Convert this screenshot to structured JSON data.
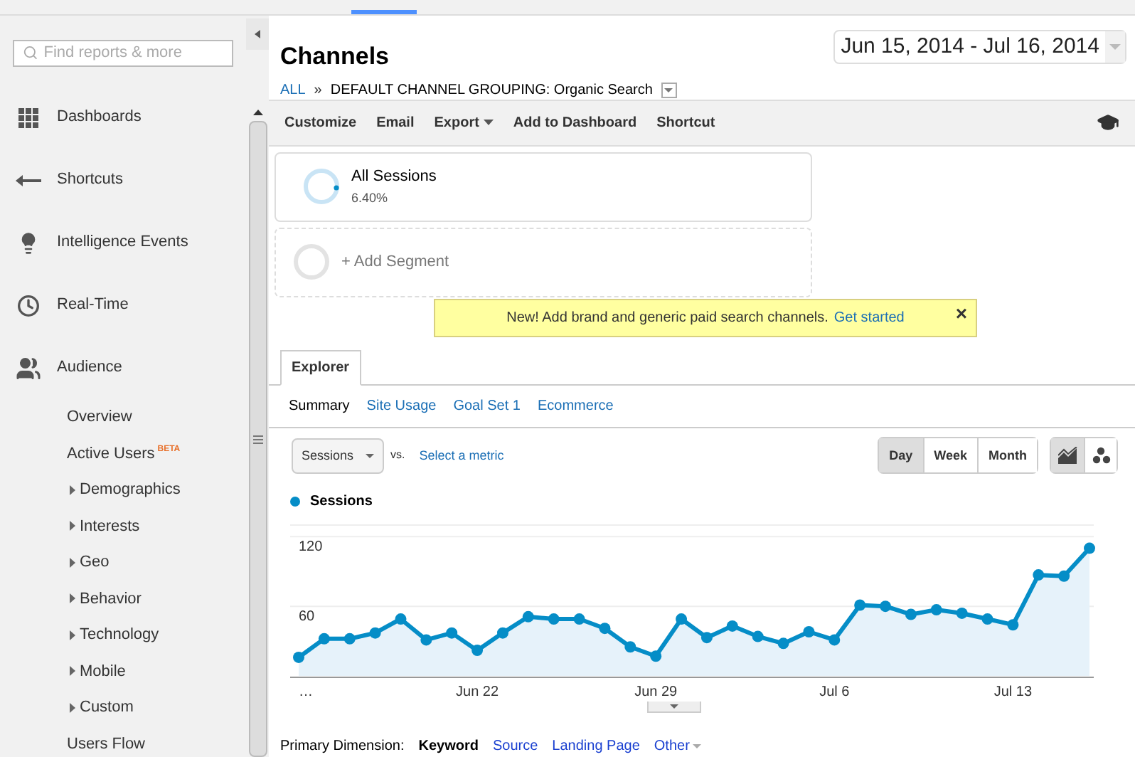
{
  "sidebar": {
    "search": {
      "placeholder": "Find reports & more"
    },
    "nav": [
      {
        "label": "Dashboards"
      },
      {
        "label": "Shortcuts"
      },
      {
        "label": "Intelligence Events"
      },
      {
        "label": "Real-Time"
      },
      {
        "label": "Audience"
      }
    ],
    "audience_items": [
      {
        "label": "Overview",
        "expandable": false
      },
      {
        "label": "Active Users",
        "badge": "BETA",
        "expandable": false
      },
      {
        "label": "Demographics",
        "expandable": true
      },
      {
        "label": "Interests",
        "expandable": true
      },
      {
        "label": "Geo",
        "expandable": true
      },
      {
        "label": "Behavior",
        "expandable": true
      },
      {
        "label": "Technology",
        "expandable": true
      },
      {
        "label": "Mobile",
        "expandable": true
      },
      {
        "label": "Custom",
        "expandable": true
      },
      {
        "label": "Users Flow",
        "expandable": false
      }
    ]
  },
  "header": {
    "title": "Channels",
    "breadcrumb": {
      "root": "ALL",
      "separator": "»",
      "current": "DEFAULT CHANNEL GROUPING: Organic Search"
    },
    "date_range": "Jun 15, 2014 - Jul 16, 2014"
  },
  "toolbar": [
    {
      "label": "Customize",
      "dropdown": false
    },
    {
      "label": "Email",
      "dropdown": false
    },
    {
      "label": "Export",
      "dropdown": true
    },
    {
      "label": "Add to Dashboard",
      "dropdown": false
    },
    {
      "label": "Shortcut",
      "dropdown": false
    }
  ],
  "segments": [
    {
      "kind": "active",
      "name": "All Sessions",
      "value": "6.40%"
    },
    {
      "kind": "add",
      "name": "+ Add Segment"
    }
  ],
  "notice": {
    "text": "New! Add brand and generic paid search channels.",
    "link": "Get started",
    "close": "×"
  },
  "tabs": [
    {
      "label": "Explorer",
      "selected": true
    }
  ],
  "subtabs": [
    {
      "label": "Summary",
      "selected": true
    },
    {
      "label": "Site Usage",
      "selected": false
    },
    {
      "label": "Goal Set 1",
      "selected": false
    },
    {
      "label": "Ecommerce",
      "selected": false
    }
  ],
  "metric": {
    "value": "Sessions",
    "vs": "vs.",
    "select": "Select a metric"
  },
  "periods": [
    {
      "label": "Day",
      "selected": true
    },
    {
      "label": "Week",
      "selected": false
    },
    {
      "label": "Month",
      "selected": false
    }
  ],
  "chart_types": [
    {
      "kind": "line",
      "selected": true
    },
    {
      "kind": "motion",
      "selected": false
    }
  ],
  "chart": {
    "chart_data": {
      "type": "area",
      "x": [
        "…",
        null,
        null,
        null,
        null,
        null,
        null,
        "Jun 22",
        null,
        null,
        null,
        null,
        null,
        null,
        "Jun 29",
        null,
        null,
        null,
        null,
        null,
        null,
        "Jul 6",
        null,
        null,
        null,
        null,
        null,
        null,
        "Jul 13",
        null,
        null,
        null
      ],
      "series": [
        {
          "name": "Sessions",
          "color": "#058dc7",
          "values": [
            16,
            32,
            32,
            37,
            49,
            31,
            37,
            22,
            37,
            51,
            49,
            49,
            41,
            25,
            17,
            49,
            33,
            43,
            34,
            28,
            38,
            31,
            61,
            60,
            53,
            57,
            54,
            49,
            44,
            87,
            86,
            110
          ]
        }
      ],
      "ylim": [
        0,
        130
      ],
      "yticks": [
        60,
        120
      ]
    }
  },
  "primary_dimension": {
    "label": "Primary Dimension:",
    "options": [
      {
        "label": "Keyword",
        "selected": true,
        "dropdown": false
      },
      {
        "label": "Source",
        "selected": false,
        "dropdown": false
      },
      {
        "label": "Landing Page",
        "selected": false,
        "dropdown": false
      },
      {
        "label": "Other",
        "selected": false,
        "dropdown": true
      }
    ]
  }
}
